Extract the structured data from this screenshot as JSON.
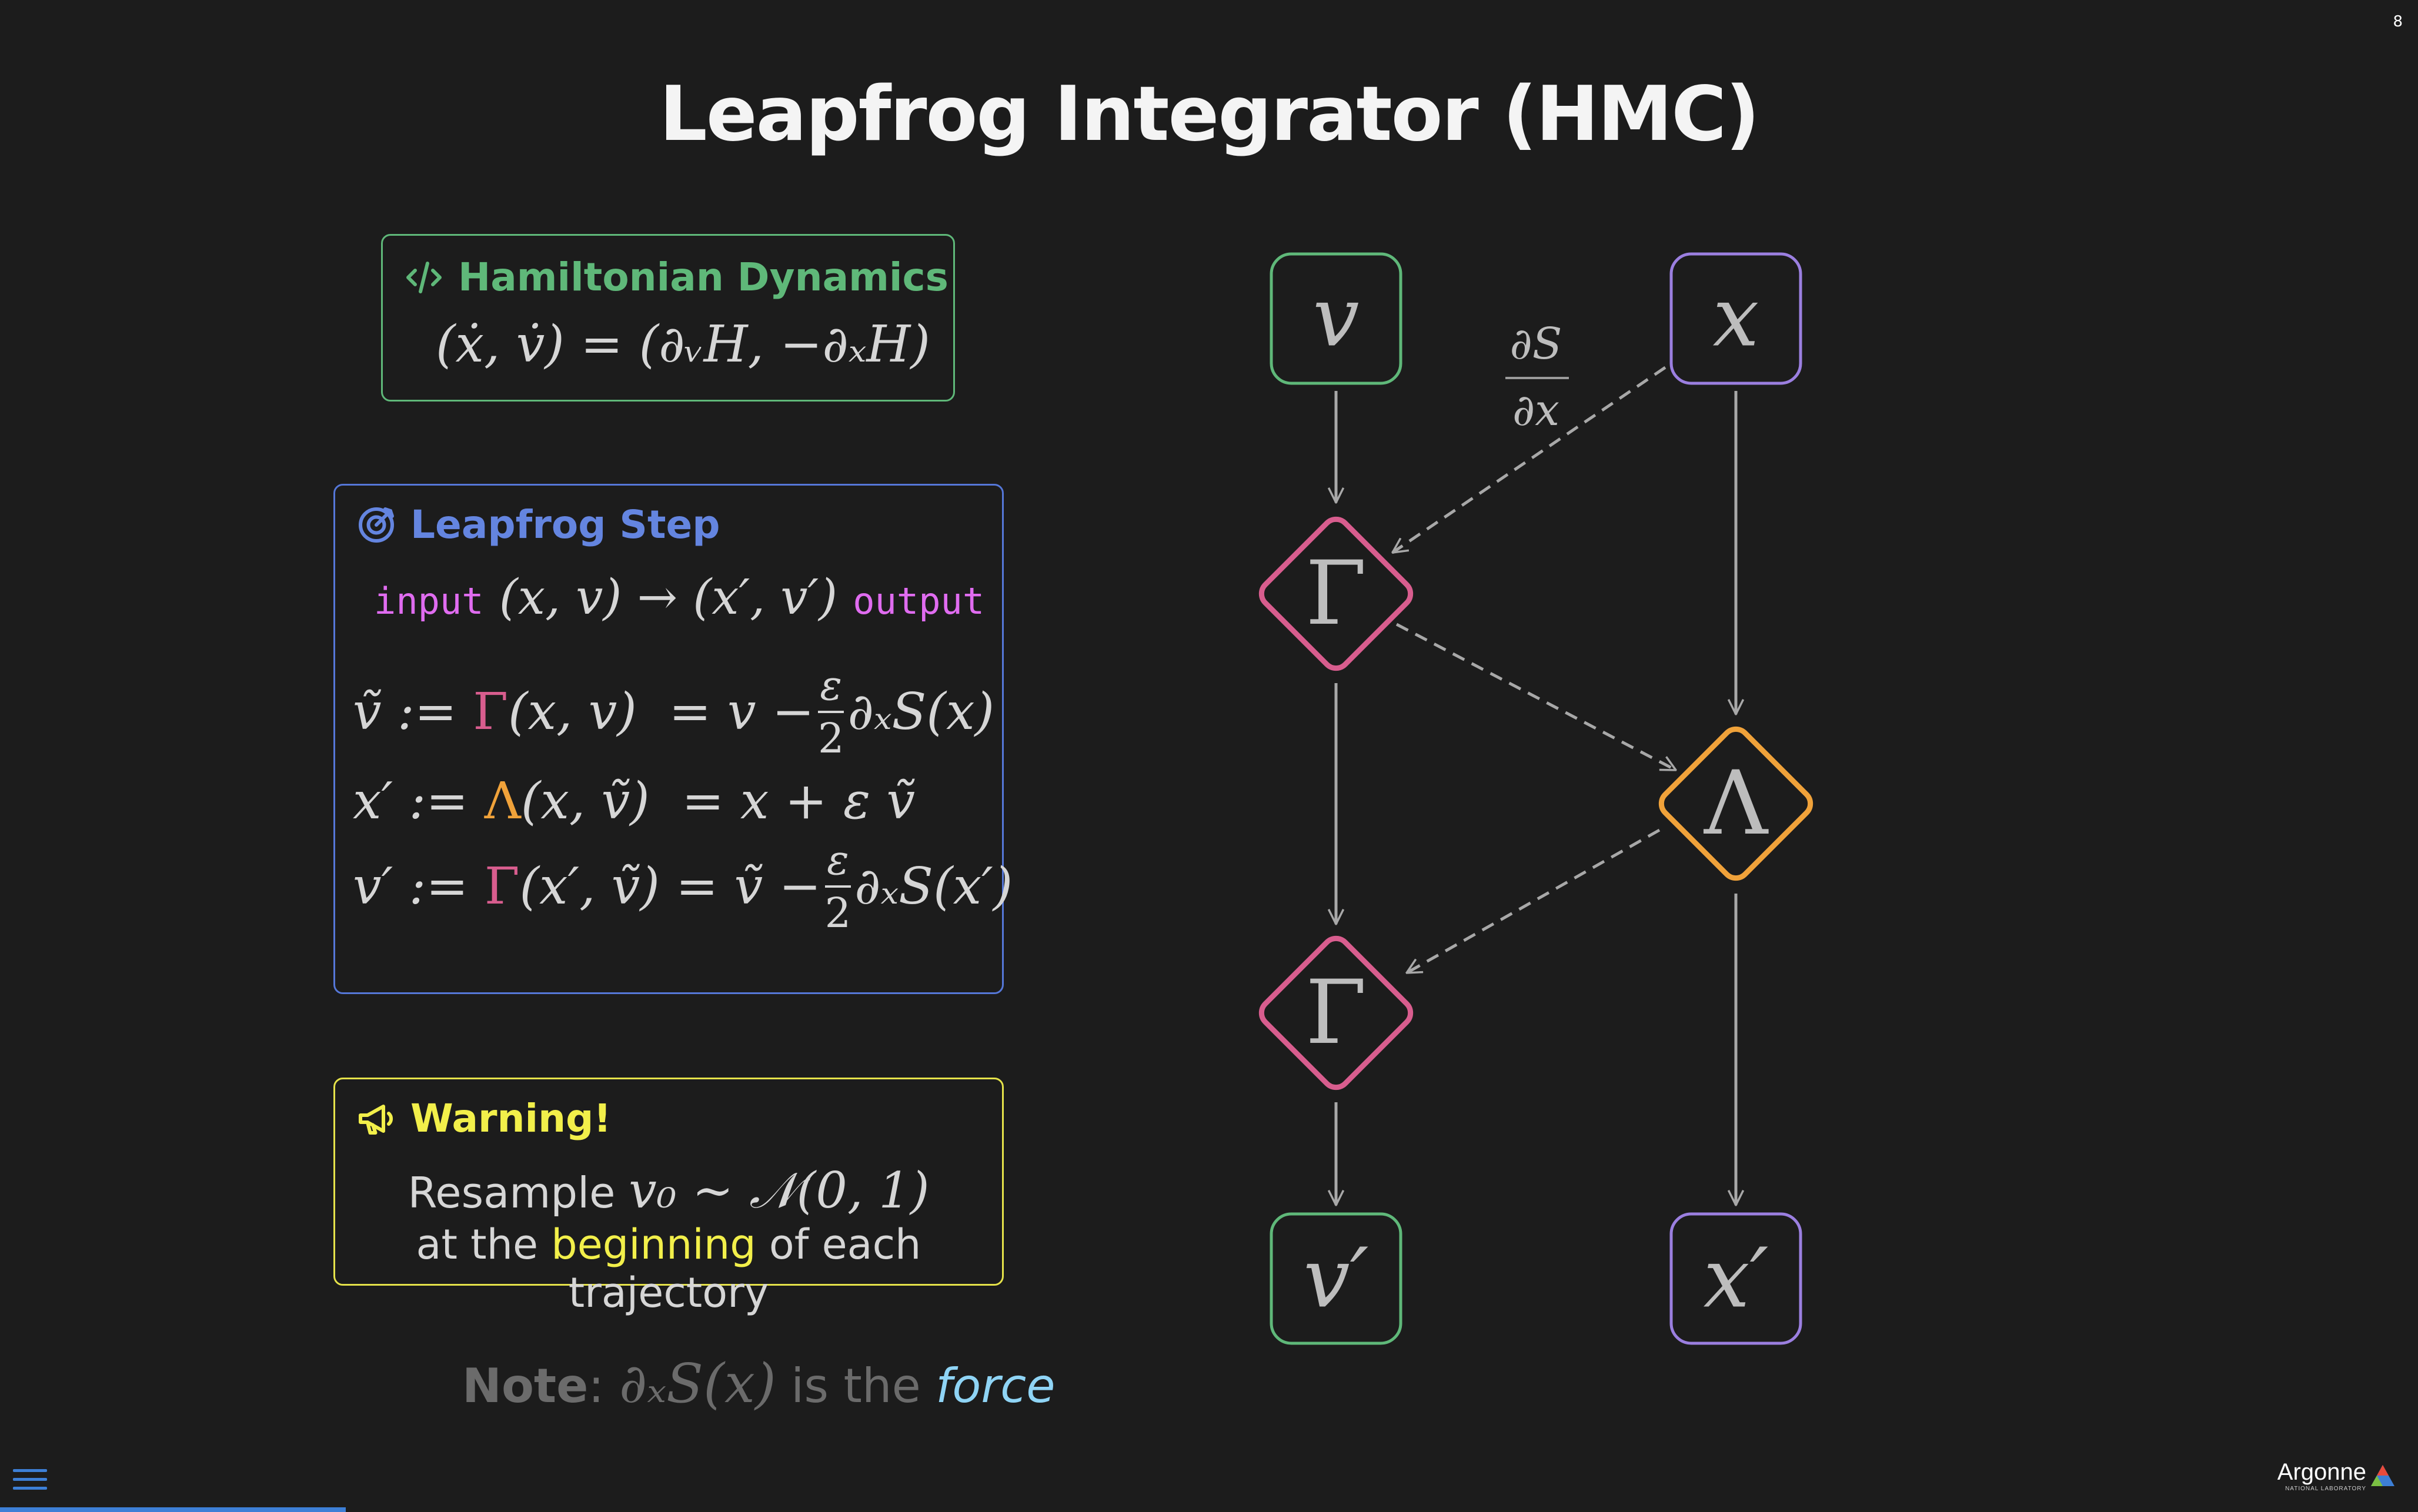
{
  "slide": {
    "number": "8",
    "title": "Leapfrog Integrator (HMC)"
  },
  "hamiltonian": {
    "heading": "Hamiltonian Dynamics",
    "icon": "code-icon",
    "equation": "(ẋ, v̇) = (∂ᵥH, −∂ₓH)",
    "color": "#5fb879"
  },
  "leapfrog": {
    "heading": "Leapfrog Step",
    "icon": "target-icon",
    "color": "#6485e0",
    "input_label": "input",
    "output_label": "output",
    "mapping": "(x, v) → (x′, v′)",
    "eq1": {
      "lhs": "ṽ :=",
      "op": "Γ",
      "args": "(x, v)",
      "mid": "= v −",
      "num": "ε",
      "den": "2",
      "rhs": "∂ₓS(x)"
    },
    "eq2": {
      "lhs": "x′ :=",
      "op": "Λ",
      "args": "(x, ṽ)",
      "rhs": "= x + ε ṽ"
    },
    "eq3": {
      "lhs": "v′ :=",
      "op": "Γ",
      "args": "(x′, ṽ)",
      "mid": "= ṽ −",
      "num": "ε",
      "den": "2",
      "rhs": "∂ₓS(x′)"
    }
  },
  "warning": {
    "heading": "Warning!",
    "icon": "megaphone-icon",
    "color": "#f2ef4a",
    "line1_text": "Resample ",
    "line1_math": "v₀ ∼ 𝒩(0, 1)",
    "line2_pre": "at the ",
    "line2_highlight": "beginning",
    "line2_post": " of each trajectory"
  },
  "note": {
    "label": "Note",
    "colon": ":",
    "math": "∂ₓS(x)",
    "middle": " is the ",
    "emph": "force"
  },
  "diagram": {
    "nodes": {
      "v": "v",
      "x": "x",
      "gamma1": "Γ",
      "lambda": "Λ",
      "gamma2": "Γ",
      "v_prime": "v′",
      "x_prime": "x′"
    },
    "edge_label_num": "∂S",
    "edge_label_den": "∂x",
    "colors": {
      "v": "#5fb879",
      "x": "#9b7fe0",
      "gamma": "#d85d8e",
      "lambda": "#f0a23a"
    }
  },
  "footer": {
    "logo_word": "Argonne",
    "logo_sub": "NATIONAL LABORATORY",
    "progress_fraction": 0.143
  }
}
